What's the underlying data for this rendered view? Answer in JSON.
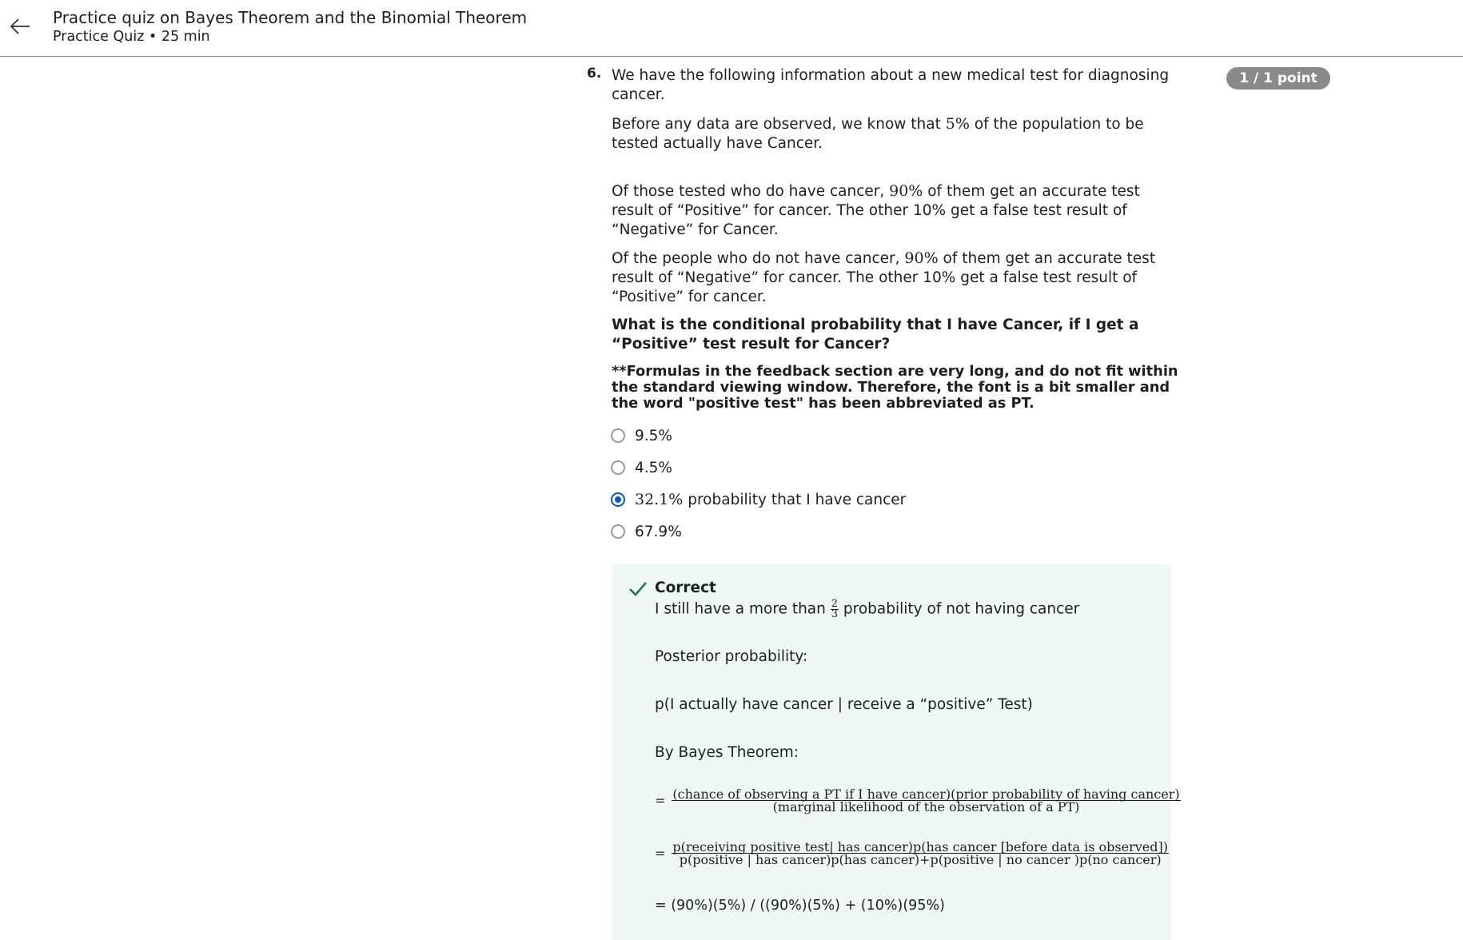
{
  "header": {
    "title": "Practice quiz on Bayes Theorem and the Binomial Theorem",
    "subtitle": "Practice Quiz • 25 min"
  },
  "question": {
    "number": "6.",
    "points": "1 / 1 point",
    "intro": "We have the following information about a new medical test for diagnosing cancer.",
    "p1_a": "Before any data are observed, we know that ",
    "p1_num": "5%",
    "p1_b": " of the population to be tested actually have Cancer.",
    "p2_a": "Of those tested who do have cancer, ",
    "p2_num": "90%",
    "p2_b": " of them get an accurate test result of “Positive” for cancer. The other 10% get a false test result of “Negative” for Cancer.",
    "p3_a": "Of the people who do not have cancer, ",
    "p3_num": "90%",
    "p3_b": " of them get an accurate test result of “Negative” for cancer. The other 10% get a false test result of “Positive” for cancer.",
    "prompt": "What is the conditional probability that I have Cancer, if I get a “Positive” test result for Cancer?",
    "note": "**Formulas in the feedback section are very long, and do not fit within the standard viewing window. Therefore, the font is a bit smaller and the word \"positive test\" has been abbreviated as PT."
  },
  "options": [
    {
      "label": "9.5%",
      "selected": false
    },
    {
      "label": "4.5%",
      "selected": false
    },
    {
      "label_num": "32.1%",
      "label_rest": " probability that I have cancer",
      "selected": true
    },
    {
      "label": "67.9%",
      "selected": false
    }
  ],
  "feedback": {
    "status": "Correct",
    "line1_a": "I still have a more than ",
    "frac_num": "2",
    "frac_den": "3",
    "line1_b": " probability of not having cancer",
    "posterior_label": "Posterior probability:",
    "posterior_expr": "p(I actually have cancer | receive a “positive” Test)",
    "bayes_label": "By Bayes Theorem:",
    "f1_eq": "=",
    "f1_num": "(chance of observing a PT if I have cancer)(prior probability of having cancer)",
    "f1_den": "(marginal likelihood of the observation of a PT)",
    "f2_eq": "=",
    "f2_num": "p(receiving positive test| has cancer)p(has cancer [before data is observed])",
    "f2_den": "p(positive | has cancer)p(has cancer)+p(positive | no cancer )p(no cancer)",
    "f3": "= (90%)(5%) / ((90%)(5%) + (10%)(95%)"
  },
  "colors": {
    "accent": "#0a56d3",
    "correct_green": "#1b7a4f",
    "feedback_bg": "#f0f8f5",
    "points_badge": "#8a8a8a"
  }
}
